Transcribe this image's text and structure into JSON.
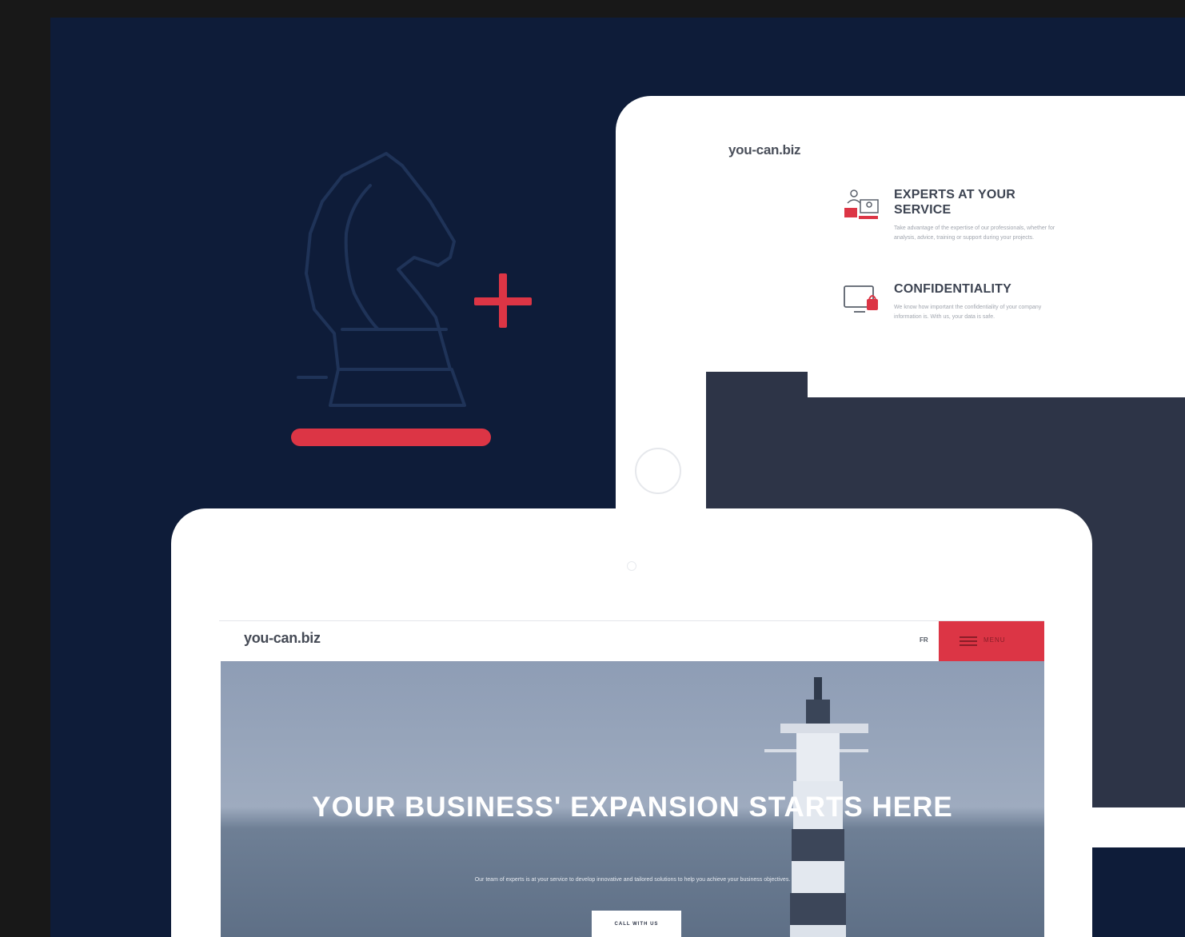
{
  "colors": {
    "background_outer": "#181818",
    "background_navy": "#0e1c39",
    "accent_red": "#dc3545",
    "knight_outline": "#1f3358",
    "dark_panel": "#2d3447"
  },
  "illustration": {
    "icons": [
      "chess-knight-icon",
      "plus-icon"
    ]
  },
  "back_tablet": {
    "logo": "you-can.biz",
    "features": [
      {
        "icon": "experts-people-icon",
        "title": "EXPERTS AT YOUR SERVICE",
        "text": "Take advantage of the expertise of our professionals, whether for analysis, advice, training or support during your projects."
      },
      {
        "icon": "confidentiality-monitor-lock-icon",
        "title": "CONFIDENTIALITY",
        "text": "We know how important the confidentiality of your company information is. With us, your data is safe."
      }
    ]
  },
  "front_tablet": {
    "logo": "you-can.biz",
    "lang": "FR",
    "menu_label": "MENU",
    "hero": {
      "title": "YOUR BUSINESS' EXPANSION STARTS HERE",
      "subtitle": "Our team of experts is at your service to develop innovative and tailored solutions to help you achieve your business objectives.",
      "cta": "CALL WITH US"
    }
  }
}
